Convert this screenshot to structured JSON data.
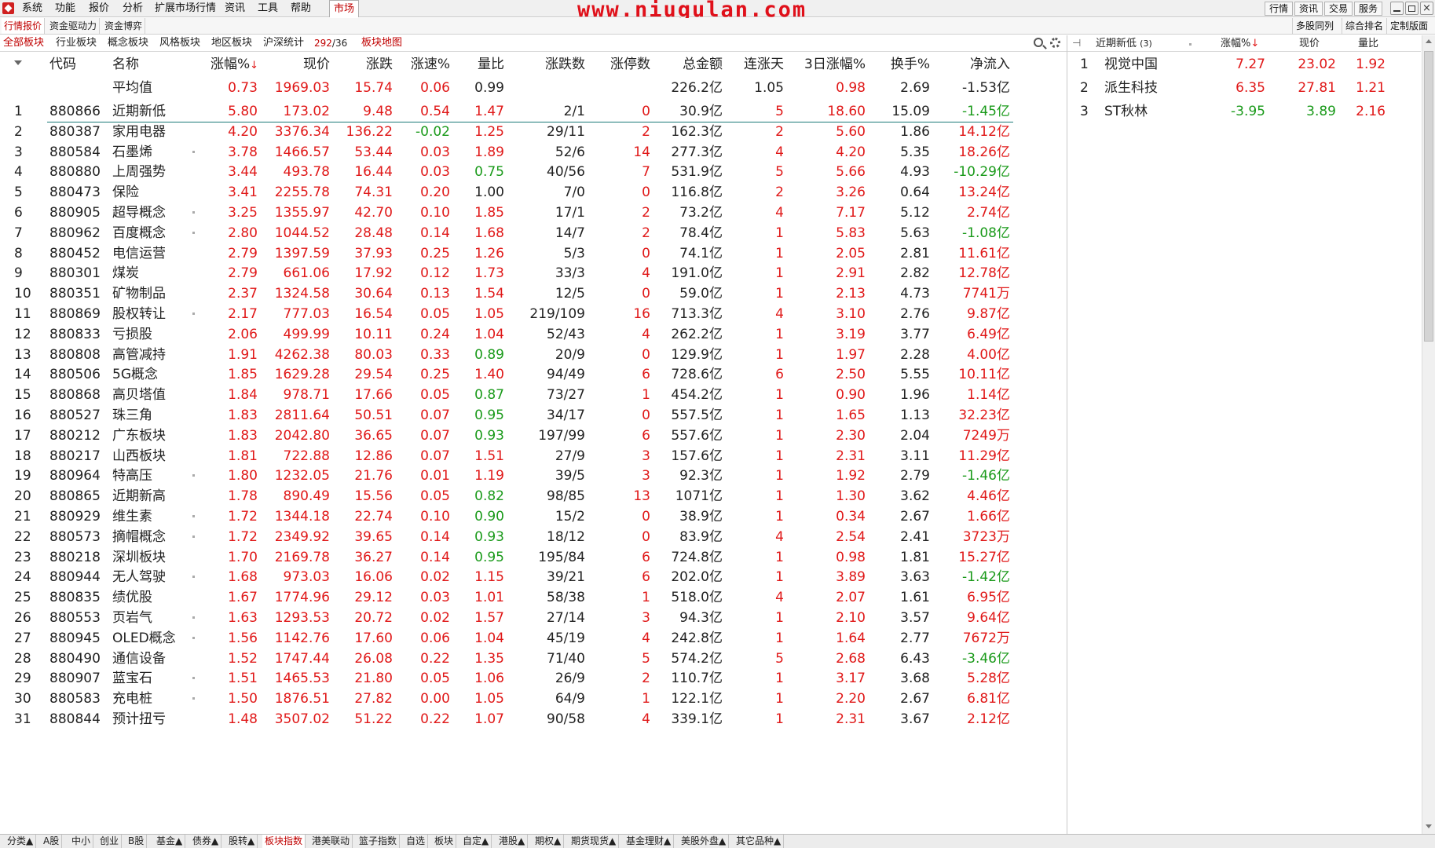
{
  "menu": {
    "items": [
      "系统",
      "功能",
      "报价",
      "分析",
      "扩展市场行情",
      "资讯",
      "工具",
      "帮助"
    ],
    "active": "市场",
    "watermark": "www.niugulan.com",
    "right_buttons": [
      "行情",
      "资讯",
      "交易",
      "服务"
    ]
  },
  "subbar": {
    "tabs": [
      "行情报价",
      "资金驱动力",
      "资金博弈"
    ],
    "right_tabs": [
      "多股同列",
      "综合排名",
      "定制版面"
    ]
  },
  "catbar": {
    "tabs": [
      "全部板块",
      "行业板块",
      "概念板块",
      "风格板块",
      "地区板块",
      "沪深统计"
    ],
    "count_up": "292",
    "count_sep": "/",
    "count_down": "36",
    "map": "板块地图"
  },
  "table": {
    "headers": {
      "code": "代码",
      "name": "名称",
      "chg": "涨幅%",
      "price": "现价",
      "diff": "涨跌",
      "speed": "涨速%",
      "vr": "量比",
      "updown": "涨跌数",
      "limit": "涨停数",
      "amount": "总金额",
      "days": "连涨天",
      "chg3": "3日涨幅%",
      "turn": "换手%",
      "net": "净流入",
      "sort_arrow": "↓"
    },
    "avg": {
      "name": "平均值",
      "chg": "0.73",
      "price": "1969.03",
      "diff": "15.74",
      "speed": "0.06",
      "vr": "0.99",
      "amount": "226.2亿",
      "days": "1.05",
      "chg3": "0.98",
      "turn": "2.69",
      "net": "-1.53亿"
    },
    "rows": [
      {
        "no": "1",
        "code": "880866",
        "name": "近期新低",
        "chg": "5.80",
        "price": "173.02",
        "diff": "9.48",
        "speed": "0.54",
        "vr": "1.47",
        "updown": "2/1",
        "limit": "0",
        "amount": "30.9亿",
        "days": "5",
        "chg3": "18.60",
        "turn": "15.09",
        "net": "-1.45亿",
        "dot": false
      },
      {
        "no": "2",
        "code": "880387",
        "name": "家用电器",
        "chg": "4.20",
        "price": "3376.34",
        "diff": "136.22",
        "speed": "-0.02",
        "vr": "1.25",
        "updown": "29/11",
        "limit": "2",
        "amount": "162.3亿",
        "days": "2",
        "chg3": "5.60",
        "turn": "1.86",
        "net": "14.12亿",
        "dot": false
      },
      {
        "no": "3",
        "code": "880584",
        "name": "石墨烯",
        "chg": "3.78",
        "price": "1466.57",
        "diff": "53.44",
        "speed": "0.03",
        "vr": "1.89",
        "updown": "52/6",
        "limit": "14",
        "amount": "277.3亿",
        "days": "4",
        "chg3": "4.20",
        "turn": "5.35",
        "net": "18.26亿",
        "dot": true
      },
      {
        "no": "4",
        "code": "880880",
        "name": "上周强势",
        "chg": "3.44",
        "price": "493.78",
        "diff": "16.44",
        "speed": "0.03",
        "vr": "0.75",
        "updown": "40/56",
        "limit": "7",
        "amount": "531.9亿",
        "days": "5",
        "chg3": "5.66",
        "turn": "4.93",
        "net": "-10.29亿",
        "dot": false
      },
      {
        "no": "5",
        "code": "880473",
        "name": "保险",
        "chg": "3.41",
        "price": "2255.78",
        "diff": "74.31",
        "speed": "0.20",
        "vr": "1.00",
        "updown": "7/0",
        "limit": "0",
        "amount": "116.8亿",
        "days": "2",
        "chg3": "3.26",
        "turn": "0.64",
        "net": "13.24亿",
        "dot": false
      },
      {
        "no": "6",
        "code": "880905",
        "name": "超导概念",
        "chg": "3.25",
        "price": "1355.97",
        "diff": "42.70",
        "speed": "0.10",
        "vr": "1.85",
        "updown": "17/1",
        "limit": "2",
        "amount": "73.2亿",
        "days": "4",
        "chg3": "7.17",
        "turn": "5.12",
        "net": "2.74亿",
        "dot": true
      },
      {
        "no": "7",
        "code": "880962",
        "name": "百度概念",
        "chg": "2.80",
        "price": "1044.52",
        "diff": "28.48",
        "speed": "0.14",
        "vr": "1.68",
        "updown": "14/7",
        "limit": "2",
        "amount": "78.4亿",
        "days": "1",
        "chg3": "5.83",
        "turn": "5.63",
        "net": "-1.08亿",
        "dot": true
      },
      {
        "no": "8",
        "code": "880452",
        "name": "电信运营",
        "chg": "2.79",
        "price": "1397.59",
        "diff": "37.93",
        "speed": "0.25",
        "vr": "1.26",
        "updown": "5/3",
        "limit": "0",
        "amount": "74.1亿",
        "days": "1",
        "chg3": "2.05",
        "turn": "2.81",
        "net": "11.61亿",
        "dot": false
      },
      {
        "no": "9",
        "code": "880301",
        "name": "煤炭",
        "chg": "2.79",
        "price": "661.06",
        "diff": "17.92",
        "speed": "0.12",
        "vr": "1.73",
        "updown": "33/3",
        "limit": "4",
        "amount": "191.0亿",
        "days": "1",
        "chg3": "2.91",
        "turn": "2.82",
        "net": "12.78亿",
        "dot": false
      },
      {
        "no": "10",
        "code": "880351",
        "name": "矿物制品",
        "chg": "2.37",
        "price": "1324.58",
        "diff": "30.64",
        "speed": "0.13",
        "vr": "1.54",
        "updown": "12/5",
        "limit": "0",
        "amount": "59.0亿",
        "days": "1",
        "chg3": "2.13",
        "turn": "4.73",
        "net": "7741万",
        "dot": false
      },
      {
        "no": "11",
        "code": "880869",
        "name": "股权转让",
        "chg": "2.17",
        "price": "777.03",
        "diff": "16.54",
        "speed": "0.05",
        "vr": "1.05",
        "updown": "219/109",
        "limit": "16",
        "amount": "713.3亿",
        "days": "4",
        "chg3": "3.10",
        "turn": "2.76",
        "net": "9.87亿",
        "dot": true
      },
      {
        "no": "12",
        "code": "880833",
        "name": "亏损股",
        "chg": "2.06",
        "price": "499.99",
        "diff": "10.11",
        "speed": "0.24",
        "vr": "1.04",
        "updown": "52/43",
        "limit": "4",
        "amount": "262.2亿",
        "days": "1",
        "chg3": "3.19",
        "turn": "3.77",
        "net": "6.49亿",
        "dot": false
      },
      {
        "no": "13",
        "code": "880808",
        "name": "高管减持",
        "chg": "1.91",
        "price": "4262.38",
        "diff": "80.03",
        "speed": "0.33",
        "vr": "0.89",
        "updown": "20/9",
        "limit": "0",
        "amount": "129.9亿",
        "days": "1",
        "chg3": "1.97",
        "turn": "2.28",
        "net": "4.00亿",
        "dot": false
      },
      {
        "no": "14",
        "code": "880506",
        "name": "5G概念",
        "chg": "1.85",
        "price": "1629.28",
        "diff": "29.54",
        "speed": "0.25",
        "vr": "1.40",
        "updown": "94/49",
        "limit": "6",
        "amount": "728.6亿",
        "days": "6",
        "chg3": "2.50",
        "turn": "5.55",
        "net": "10.11亿",
        "dot": false
      },
      {
        "no": "15",
        "code": "880868",
        "name": "高贝塔值",
        "chg": "1.84",
        "price": "978.71",
        "diff": "17.66",
        "speed": "0.05",
        "vr": "0.87",
        "updown": "73/27",
        "limit": "1",
        "amount": "454.2亿",
        "days": "1",
        "chg3": "0.90",
        "turn": "1.96",
        "net": "1.14亿",
        "dot": false
      },
      {
        "no": "16",
        "code": "880527",
        "name": "珠三角",
        "chg": "1.83",
        "price": "2811.64",
        "diff": "50.51",
        "speed": "0.07",
        "vr": "0.95",
        "updown": "34/17",
        "limit": "0",
        "amount": "557.5亿",
        "days": "1",
        "chg3": "1.65",
        "turn": "1.13",
        "net": "32.23亿",
        "dot": false
      },
      {
        "no": "17",
        "code": "880212",
        "name": "广东板块",
        "chg": "1.83",
        "price": "2042.80",
        "diff": "36.65",
        "speed": "0.07",
        "vr": "0.93",
        "updown": "197/99",
        "limit": "6",
        "amount": "557.6亿",
        "days": "1",
        "chg3": "2.30",
        "turn": "2.04",
        "net": "7249万",
        "dot": false
      },
      {
        "no": "18",
        "code": "880217",
        "name": "山西板块",
        "chg": "1.81",
        "price": "722.88",
        "diff": "12.86",
        "speed": "0.07",
        "vr": "1.51",
        "updown": "27/9",
        "limit": "3",
        "amount": "157.6亿",
        "days": "1",
        "chg3": "2.31",
        "turn": "3.11",
        "net": "11.29亿",
        "dot": false
      },
      {
        "no": "19",
        "code": "880964",
        "name": "特高压",
        "chg": "1.80",
        "price": "1232.05",
        "diff": "21.76",
        "speed": "0.01",
        "vr": "1.19",
        "updown": "39/5",
        "limit": "3",
        "amount": "92.3亿",
        "days": "1",
        "chg3": "1.92",
        "turn": "2.79",
        "net": "-1.46亿",
        "dot": true
      },
      {
        "no": "20",
        "code": "880865",
        "name": "近期新高",
        "chg": "1.78",
        "price": "890.49",
        "diff": "15.56",
        "speed": "0.05",
        "vr": "0.82",
        "updown": "98/85",
        "limit": "13",
        "amount": "1071亿",
        "days": "1",
        "chg3": "1.30",
        "turn": "3.62",
        "net": "4.46亿",
        "dot": false
      },
      {
        "no": "21",
        "code": "880929",
        "name": "维生素",
        "chg": "1.72",
        "price": "1344.18",
        "diff": "22.74",
        "speed": "0.10",
        "vr": "0.90",
        "updown": "15/2",
        "limit": "0",
        "amount": "38.9亿",
        "days": "1",
        "chg3": "0.34",
        "turn": "2.67",
        "net": "1.66亿",
        "dot": true
      },
      {
        "no": "22",
        "code": "880573",
        "name": "摘帽概念",
        "chg": "1.72",
        "price": "2349.92",
        "diff": "39.65",
        "speed": "0.14",
        "vr": "0.93",
        "updown": "18/12",
        "limit": "0",
        "amount": "83.9亿",
        "days": "4",
        "chg3": "2.54",
        "turn": "2.41",
        "net": "3723万",
        "dot": true
      },
      {
        "no": "23",
        "code": "880218",
        "name": "深圳板块",
        "chg": "1.70",
        "price": "2169.78",
        "diff": "36.27",
        "speed": "0.14",
        "vr": "0.95",
        "updown": "195/84",
        "limit": "6",
        "amount": "724.8亿",
        "days": "1",
        "chg3": "0.98",
        "turn": "1.81",
        "net": "15.27亿",
        "dot": false
      },
      {
        "no": "24",
        "code": "880944",
        "name": "无人驾驶",
        "chg": "1.68",
        "price": "973.03",
        "diff": "16.06",
        "speed": "0.02",
        "vr": "1.15",
        "updown": "39/21",
        "limit": "6",
        "amount": "202.0亿",
        "days": "1",
        "chg3": "3.89",
        "turn": "3.63",
        "net": "-1.42亿",
        "dot": true
      },
      {
        "no": "25",
        "code": "880835",
        "name": "绩优股",
        "chg": "1.67",
        "price": "1774.96",
        "diff": "29.12",
        "speed": "0.03",
        "vr": "1.01",
        "updown": "58/38",
        "limit": "1",
        "amount": "518.0亿",
        "days": "4",
        "chg3": "2.07",
        "turn": "1.61",
        "net": "6.95亿",
        "dot": false
      },
      {
        "no": "26",
        "code": "880553",
        "name": "页岩气",
        "chg": "1.63",
        "price": "1293.53",
        "diff": "20.72",
        "speed": "0.02",
        "vr": "1.57",
        "updown": "27/14",
        "limit": "3",
        "amount": "94.3亿",
        "days": "1",
        "chg3": "2.10",
        "turn": "3.57",
        "net": "9.64亿",
        "dot": true
      },
      {
        "no": "27",
        "code": "880945",
        "name": "OLED概念",
        "chg": "1.56",
        "price": "1142.76",
        "diff": "17.60",
        "speed": "0.06",
        "vr": "1.04",
        "updown": "45/19",
        "limit": "4",
        "amount": "242.8亿",
        "days": "1",
        "chg3": "1.64",
        "turn": "2.77",
        "net": "7672万",
        "dot": true
      },
      {
        "no": "28",
        "code": "880490",
        "name": "通信设备",
        "chg": "1.52",
        "price": "1747.44",
        "diff": "26.08",
        "speed": "0.22",
        "vr": "1.35",
        "updown": "71/40",
        "limit": "5",
        "amount": "574.2亿",
        "days": "5",
        "chg3": "2.68",
        "turn": "6.43",
        "net": "-3.46亿",
        "dot": false
      },
      {
        "no": "29",
        "code": "880907",
        "name": "蓝宝石",
        "chg": "1.51",
        "price": "1465.53",
        "diff": "21.80",
        "speed": "0.05",
        "vr": "1.06",
        "updown": "26/9",
        "limit": "2",
        "amount": "110.7亿",
        "days": "1",
        "chg3": "3.17",
        "turn": "3.68",
        "net": "5.28亿",
        "dot": true
      },
      {
        "no": "30",
        "code": "880583",
        "name": "充电桩",
        "chg": "1.50",
        "price": "1876.51",
        "diff": "27.82",
        "speed": "0.00",
        "vr": "1.05",
        "updown": "64/9",
        "limit": "1",
        "amount": "122.1亿",
        "days": "1",
        "chg3": "2.20",
        "turn": "2.67",
        "net": "6.81亿",
        "dot": true
      },
      {
        "no": "31",
        "code": "880844",
        "name": "预计扭亏",
        "chg": "1.48",
        "price": "3507.02",
        "diff": "51.22",
        "speed": "0.22",
        "vr": "1.07",
        "updown": "90/58",
        "limit": "4",
        "amount": "339.1亿",
        "days": "1",
        "chg3": "2.31",
        "turn": "3.67",
        "net": "2.12亿",
        "dot": false
      }
    ]
  },
  "rpanel": {
    "title": "近期新低",
    "count": "(3)",
    "headers": {
      "chg": "涨幅%",
      "price": "现价",
      "vr": "量比",
      "sort_arrow": "↓"
    },
    "rows": [
      {
        "no": "1",
        "name": "视觉中国",
        "chg": "7.27",
        "price": "23.02",
        "vr": "1.92"
      },
      {
        "no": "2",
        "name": "派生科技",
        "chg": "6.35",
        "price": "27.81",
        "vr": "1.21"
      },
      {
        "no": "3",
        "name": "ST秋林",
        "chg": "-3.95",
        "price": "3.89",
        "vr": "2.16"
      }
    ]
  },
  "bottom": {
    "tabs": [
      "分类▲",
      "A股",
      "中小",
      "创业",
      "B股",
      "基金▲",
      "债券▲",
      "股转▲",
      "板块指数",
      "港美联动",
      "篮子指数",
      "自选",
      "板块",
      "自定▲",
      "港股▲",
      "期权▲",
      "期货现货▲",
      "基金理财▲",
      "美股外盘▲",
      "其它品种▲"
    ],
    "active": "板块指数"
  },
  "colors": {
    "up": "#e01818",
    "down": "#1a9a1a",
    "accent": "#c00000"
  }
}
